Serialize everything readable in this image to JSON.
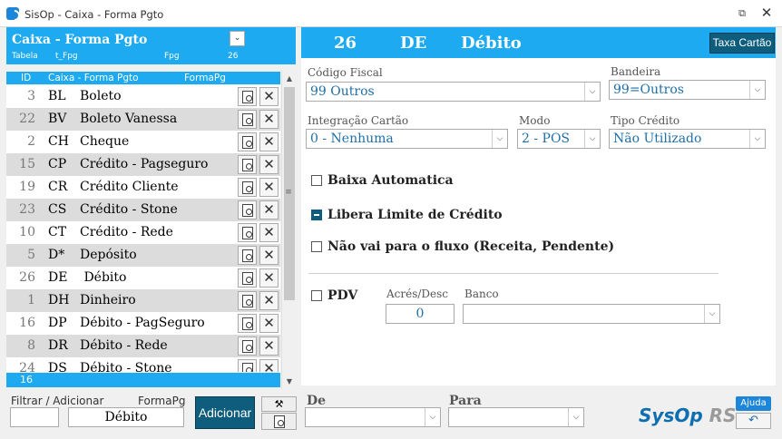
{
  "window": {
    "title": "SisOp - Caixa - Forma Pgto",
    "maximize_glyph": "⧉",
    "close_glyph": "✕"
  },
  "left_panel": {
    "title": "Caixa - Forma Pgto",
    "dropdown_glyph": "⌄",
    "sub_labels": {
      "tabela": "Tabela",
      "table_name": "t_Fpg",
      "field": "Fpg",
      "count": "26"
    },
    "columns": {
      "id": "ID",
      "caixa": "Caixa - Forma Pgto",
      "formapg": "FormaPg"
    },
    "rows": [
      {
        "id": "3",
        "code": "BL",
        "desc": "Boleto"
      },
      {
        "id": "22",
        "code": "BV",
        "desc": "Boleto Vanessa"
      },
      {
        "id": "2",
        "code": "CH",
        "desc": "Cheque"
      },
      {
        "id": "15",
        "code": "CP",
        "desc": "Crédito - Pagseguro"
      },
      {
        "id": "19",
        "code": "CR",
        "desc": "Crédito Cliente"
      },
      {
        "id": "23",
        "code": "CS",
        "desc": "Crédito - Stone"
      },
      {
        "id": "10",
        "code": "CT",
        "desc": "Crédito - Rede"
      },
      {
        "id": "5",
        "code": "D*",
        "desc": "Depósito"
      },
      {
        "id": "26",
        "code": "DE",
        "desc": " Débito"
      },
      {
        "id": "1",
        "code": "DH",
        "desc": "Dinheiro"
      },
      {
        "id": "16",
        "code": "DP",
        "desc": "Débito - PagSeguro"
      },
      {
        "id": "8",
        "code": "DR",
        "desc": "Débito - Rede"
      },
      {
        "id": "24",
        "code": "DS",
        "desc": "Débito - Stone"
      }
    ],
    "delete_glyph": "✕",
    "scroll": {
      "up": "▲",
      "down": "▼",
      "grip": "≡"
    },
    "footer_count": "16"
  },
  "bottom_left": {
    "filter_label": "Filtrar / Adicionar",
    "formapg_label": "FormaPg",
    "formapg_value": "Débito",
    "add_label": "Adicionar",
    "tool_glyph": "⚒"
  },
  "right_panel": {
    "id": "26",
    "code": "DE",
    "desc": "Débito",
    "taxa_label": "Taxa Cartão",
    "fields": {
      "codigo_fiscal_label": "Código Fiscal",
      "codigo_fiscal_value": "99 Outros",
      "bandeira_label": "Bandeira",
      "bandeira_value": "99=Outros",
      "integracao_label": "Integração Cartão",
      "integracao_value": "0 - Nenhuma",
      "modo_label": "Modo",
      "modo_value": "2 - POS",
      "tipo_credito_label": "Tipo Crédito",
      "tipo_credito_value": "Não Utilizado",
      "acres_label": "Acrés/Desc",
      "acres_value": "0",
      "banco_label": "Banco",
      "banco_value": ""
    },
    "checks": {
      "baixa_label": "Baixa Automatica",
      "libera_label": "Libera Limite de Crédito",
      "fluxo_label": "Não vai para o fluxo (Receita, Pendente)",
      "pdv_label": "PDV"
    },
    "dropdown_arrow": "⌵"
  },
  "bottom_right": {
    "de_label": "De",
    "para_label": "Para",
    "brand": "SysOp",
    "brand_suffix": "RS",
    "ajuda_label": "Ajuda",
    "back_glyph": "↶"
  }
}
